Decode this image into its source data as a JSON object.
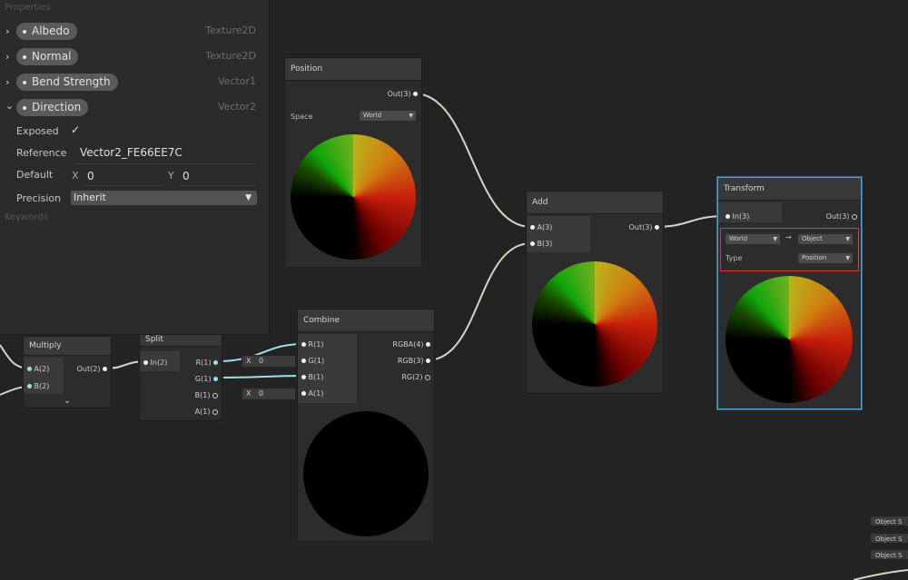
{
  "blackboard": {
    "title": "Properties",
    "properties": [
      {
        "name": "Albedo",
        "type": "Texture2D",
        "expanded": false
      },
      {
        "name": "Normal",
        "type": "Texture2D",
        "expanded": false
      },
      {
        "name": "Bend Strength",
        "type": "Vector1",
        "expanded": false
      },
      {
        "name": "Direction",
        "type": "Vector2",
        "expanded": true
      }
    ],
    "direction_fields": {
      "exposed_label": "Exposed",
      "exposed_check": "✓",
      "reference_label": "Reference",
      "reference_value": "Vector2_FE66EE7C",
      "default_label": "Default",
      "x_label": "X",
      "x_value": "0",
      "y_label": "Y",
      "y_value": "0",
      "precision_label": "Precision",
      "precision_value": "Inherit"
    },
    "keywords_title": "Keywords"
  },
  "nodes": {
    "position": {
      "title": "Position",
      "out": "Out(3)",
      "space_label": "Space",
      "space_value": "World"
    },
    "add": {
      "title": "Add",
      "in_a": "A(3)",
      "in_b": "B(3)",
      "out": "Out(3)"
    },
    "transform": {
      "title": "Transform",
      "in": "In(3)",
      "out": "Out(3)",
      "from": "World",
      "arrow": "→",
      "to": "Object",
      "type_label": "Type",
      "type_value": "Position"
    },
    "combine": {
      "title": "Combine",
      "in_r": "R(1)",
      "in_g": "G(1)",
      "in_b": "B(1)",
      "in_a": "A(1)",
      "out_rgba": "RGBA(4)",
      "out_rgb": "RGB(3)",
      "out_rg": "RG(2)",
      "g_default_x": "X",
      "g_default_val": "0",
      "a_default_x": "X",
      "a_default_val": "0"
    },
    "multiply": {
      "title": "Multiply",
      "in_a": "A(2)",
      "in_b": "B(2)",
      "out": "Out(2)"
    },
    "split": {
      "title": "Split",
      "in": "In(2)",
      "out_r": "R(1)",
      "out_g": "G(1)",
      "out_b": "B(1)",
      "out_a": "A(1)"
    }
  },
  "object_space_labels": [
    "Object S",
    "Object S",
    "Object S"
  ],
  "colors": {
    "background": "#232323",
    "node": "#2c2c2c",
    "selection": "#4aa3d8",
    "highlight": "#d23a3a",
    "wire": "#d8d4c2",
    "wire_vec1": "#9fe0e8"
  }
}
